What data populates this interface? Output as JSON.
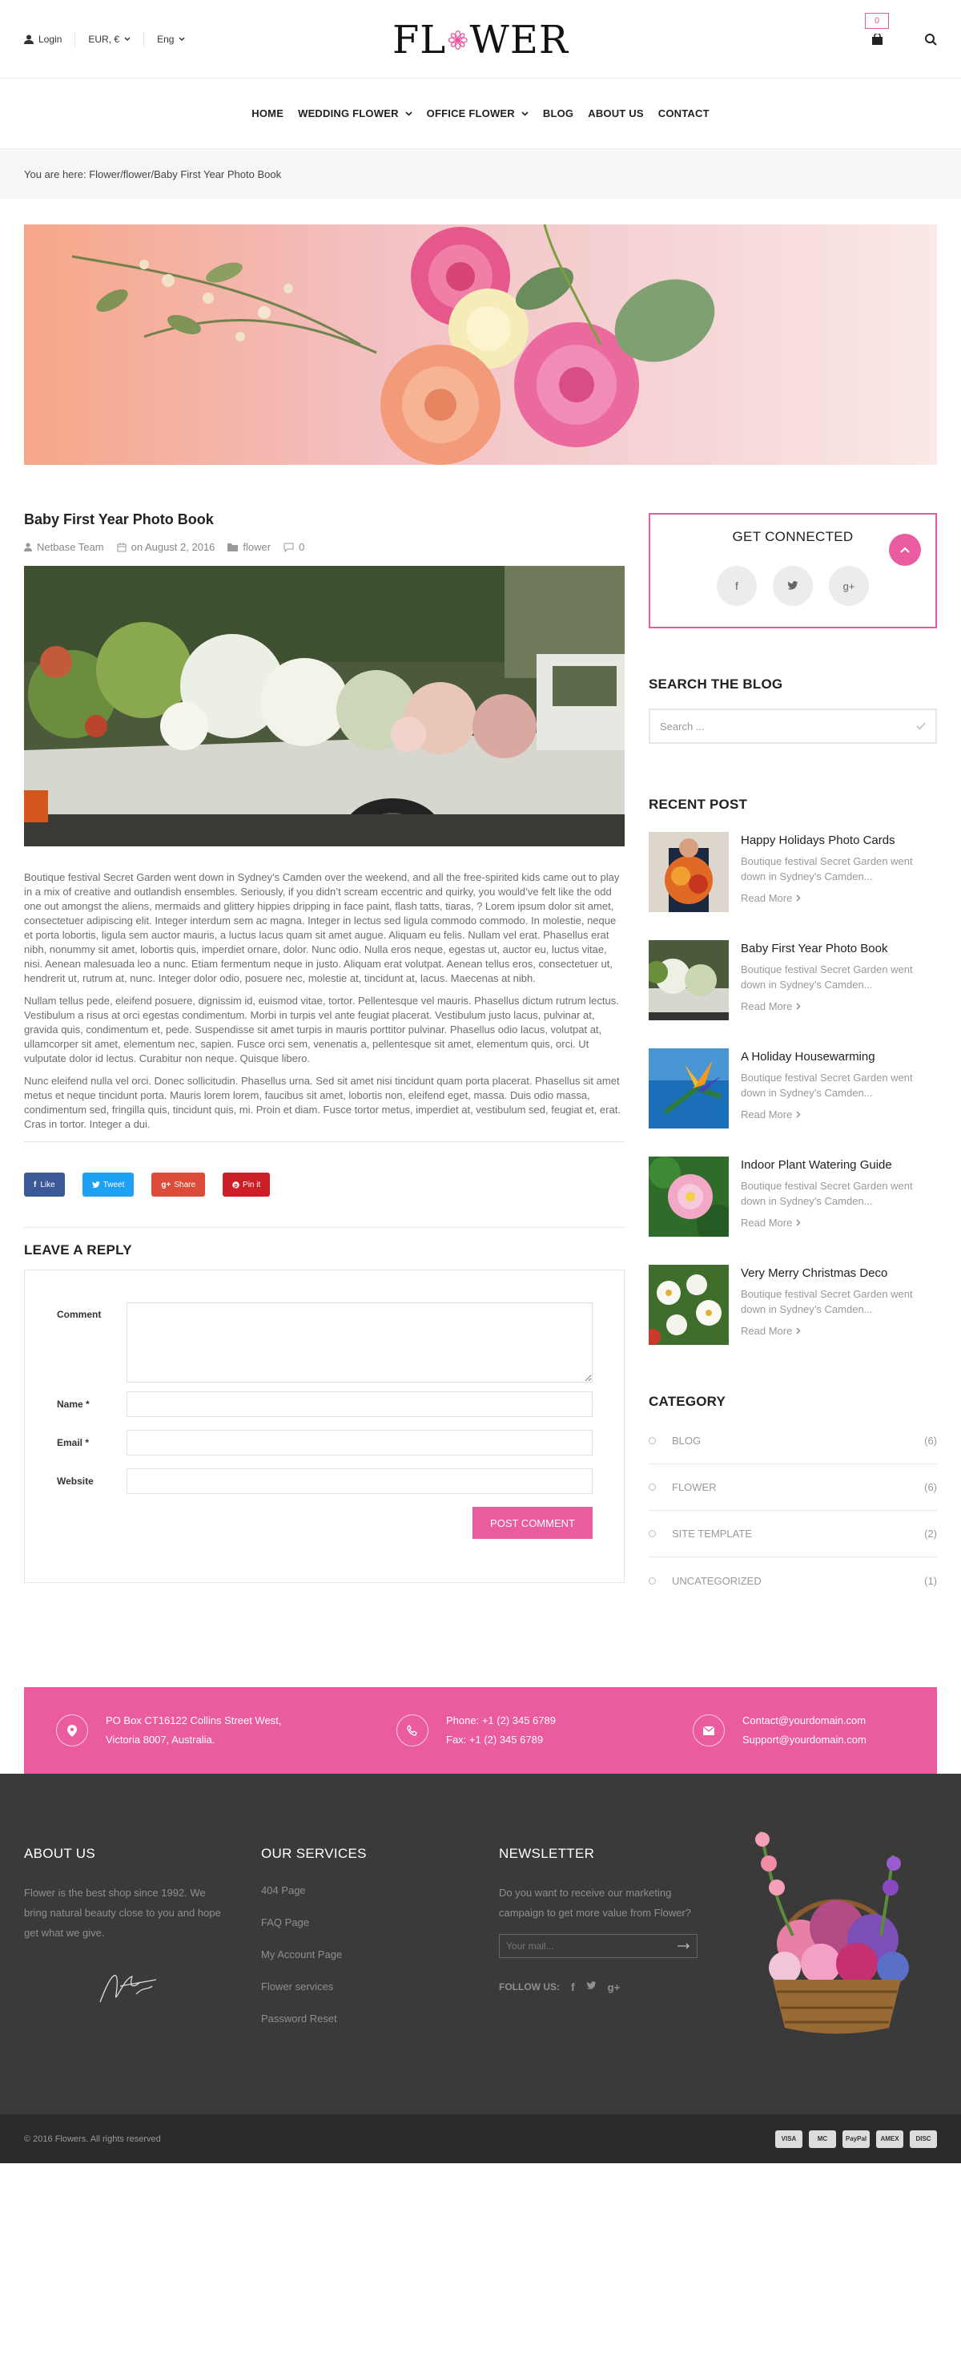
{
  "header": {
    "login": "Login",
    "currency": "EUR, €",
    "language": "Eng",
    "logo_left": "FL",
    "logo_right": "WER",
    "cart_count": "0"
  },
  "nav": {
    "items": [
      "HOME",
      "WEDDING FLOWER",
      "OFFICE FLOWER",
      "BLOG",
      "ABOUT US",
      "CONTACT"
    ]
  },
  "breadcrumb": "You are here: Flower/flower/Baby First Year Photo Book",
  "post": {
    "title": "Baby First Year Photo Book",
    "author": "Netbase Team",
    "date": "on August 2, 2016",
    "category": "flower",
    "comments": "0",
    "paragraphs": [
      "Boutique festival Secret Garden went down in Sydney’s Camden over the weekend, and all the free-spirited kids came out to play in a mix of creative and outlandish ensembles. Seriously, if you didn’t scream eccentric and quirky, you would’ve felt like the odd one out amongst the aliens, mermaids and glittery hippies dripping in face paint, flash tatts, tiaras, ? Lorem ipsum dolor sit amet, consectetuer adipiscing elit. Integer interdum sem ac magna. Integer in lectus sed ligula commodo commodo. In molestie, neque et porta lobortis, ligula sem auctor mauris, a luctus lacus quam sit amet augue. Aliquam eu felis. Nullam vel erat. Phasellus erat nibh, nonummy sit amet, lobortis quis, imperdiet ornare, dolor. Nunc odio. Nulla eros neque, egestas ut, auctor eu, luctus vitae, nisi. Aenean malesuada leo a nunc. Etiam fermentum neque in justo. Aliquam erat volutpat. Aenean tellus eros, consectetuer ut, hendrerit ut, rutrum at, nunc. Integer dolor odio, posuere nec, molestie at, tincidunt at, lacus. Maecenas at nibh.",
      "Nullam tellus pede, eleifend posuere, dignissim id, euismod vitae, tortor. Pellentesque vel mauris. Phasellus dictum rutrum lectus. Vestibulum a risus at orci egestas condimentum. Morbi in turpis vel ante feugiat placerat. Vestibulum justo lacus, pulvinar at, gravida quis, condimentum et, pede. Suspendisse sit amet turpis in mauris porttitor pulvinar. Phasellus odio lacus, volutpat at, ullamcorper sit amet, elementum nec, sapien. Fusce orci sem, venenatis a, pellentesque sit amet, elementum quis, orci. Ut vulputate dolor id lectus. Curabitur non neque. Quisque libero.",
      "Nunc eleifend nulla vel orci. Donec sollicitudin. Phasellus urna. Sed sit amet nisi tincidunt quam porta placerat. Phasellus sit amet metus et neque tincidunt porta. Mauris lorem lorem, faucibus sit amet, lobortis non, eleifend eget, massa. Duis odio massa, condimentum sed, fringilla quis, tincidunt quis, mi. Proin et diam. Fusce tortor metus, imperdiet at, vestibulum sed, feugiat et, erat. Cras in tortor. Integer a dui."
    ]
  },
  "share": {
    "like": "Like",
    "tweet": "Tweet",
    "share": "Share",
    "pin": "Pin it",
    "colors": {
      "like": "#3b5998",
      "tweet": "#1da1f2",
      "share": "#dd4b39",
      "pin": "#cb2027"
    }
  },
  "reply": {
    "title": "LEAVE A REPLY",
    "comment_label": "Comment",
    "name_label": "Name *",
    "email_label": "Email *",
    "website_label": "Website",
    "submit": "POST COMMENT"
  },
  "sidebar": {
    "get_connected": "GET CONNECTED",
    "search_title": "SEARCH THE BLOG",
    "search_placeholder": "Search ...",
    "recent_title": "RECENT POST",
    "recent": [
      {
        "title": "Happy Holidays Photo Cards",
        "excerpt": "Boutique festival Secret Garden went down in Sydney’s Camden...",
        "more": "Read More"
      },
      {
        "title": "Baby First Year Photo Book",
        "excerpt": "Boutique festival Secret Garden went down in Sydney’s Camden...",
        "more": "Read More"
      },
      {
        "title": "A Holiday Housewarming",
        "excerpt": "Boutique festival Secret Garden went down in Sydney’s Camden...",
        "more": "Read More"
      },
      {
        "title": "Indoor Plant Watering Guide",
        "excerpt": "Boutique festival Secret Garden went down in Sydney’s Camden...",
        "more": "Read More"
      },
      {
        "title": "Very Merry Christmas Deco",
        "excerpt": "Boutique festival Secret Garden went down in Sydney’s Camden...",
        "more": "Read More"
      }
    ],
    "category_title": "CATEGORY",
    "categories": [
      {
        "name": "BLOG",
        "count": "(6)"
      },
      {
        "name": "FLOWER",
        "count": "(6)"
      },
      {
        "name": "SITE TEMPLATE",
        "count": "(2)"
      },
      {
        "name": "UNCATEGORIZED",
        "count": "(1)"
      }
    ]
  },
  "contact": {
    "address1": "PO Box CT16122 Collins Street West,",
    "address2": "Victoria 8007, Australia.",
    "phone": "Phone: +1 (2) 345 6789",
    "fax": "Fax: +1 (2) 345 6789",
    "email1": "Contact@yourdomain.com",
    "email2": "Support@yourdomain.com"
  },
  "footer": {
    "about_title": "ABOUT US",
    "about_text": "Flower is the best shop since 1992. We bring natural beauty close to you and hope get what we give.",
    "services_title": "OUR SERVICES",
    "services": [
      "404 Page",
      "FAQ Page",
      "My Account Page",
      "Flower services",
      "Password Reset"
    ],
    "newsletter_title": "NEWSLETTER",
    "newsletter_text": "Do you want to receive our marketing campaign to get more value from Flower?",
    "mail_placeholder": "Your mail...",
    "follow": "FOLLOW US:",
    "copyright": "© 2016 Flowers. All rights reserved",
    "payments": [
      "VISA",
      "MC",
      "PayPal",
      "AMEX",
      "DISC"
    ]
  },
  "colors": {
    "accent": "#ea5c9f",
    "footer_bg": "#3a3a3a",
    "bottom_bg": "#2b2b2b"
  }
}
